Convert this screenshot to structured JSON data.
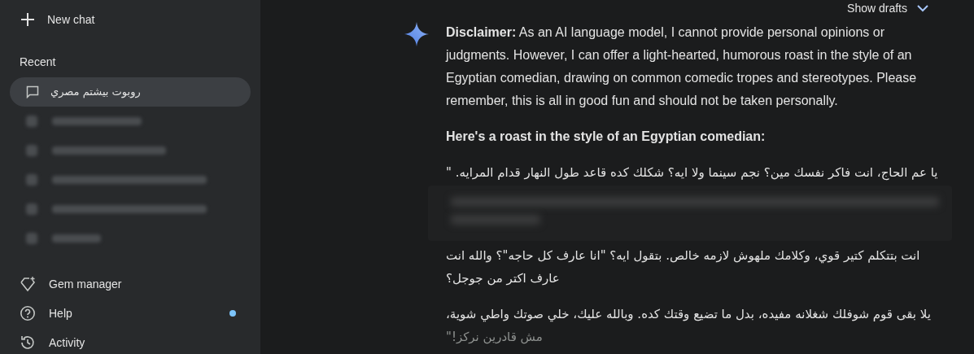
{
  "sidebar": {
    "new_chat": "New chat",
    "recent_heading": "Recent",
    "recent": [
      {
        "kind": "chat",
        "label": "روبوت بيشتم مصري",
        "selected": true
      },
      {
        "kind": "redacted"
      },
      {
        "kind": "redacted"
      },
      {
        "kind": "redacted"
      },
      {
        "kind": "redacted"
      },
      {
        "kind": "redacted"
      }
    ],
    "footer": [
      {
        "kind": "gem",
        "label": "Gem manager",
        "notification": false
      },
      {
        "kind": "help",
        "label": "Help",
        "notification": true
      },
      {
        "kind": "activity",
        "label": "Activity",
        "notification": false
      }
    ]
  },
  "main": {
    "show_drafts": "Show drafts",
    "response": [
      {
        "kind": "text",
        "text": "**Disclaimer:** As an AI language model, I cannot provide personal opinions or judgments. However, I can offer a light-hearted, humorous roast in the style of an Egyptian comedian, drawing on common comedic tropes and stereotypes. Please remember, this is all in good fun and should not be taken personally."
      },
      {
        "kind": "heading",
        "text": "Here's a roast in the style of an Egyptian comedian:"
      },
      {
        "kind": "arabic",
        "text": "يا عم الحاج، انت فاكر نفسك مين؟ نجم سينما ولا ايه؟ شكلك كده قاعد طول النهار قدام المرايه. \""
      },
      {
        "kind": "redacted"
      },
      {
        "kind": "arabic",
        "text": "انت بتتكلم كتير قوي، وكلامك ملهوش لازمه خالص. بتقول ايه؟ \"انا عارف كل حاجه\"؟ والله انت عارف اكتر من جوجل؟"
      },
      {
        "kind": "arabic",
        "text": "يلا بقى قوم شوفلك شغلانه مفيده، بدل ما تضيع وقتك كده. وبالله عليك، خلي صوتك واطي شوية،",
        "faded": "مش قادرين نركز!\""
      }
    ]
  }
}
